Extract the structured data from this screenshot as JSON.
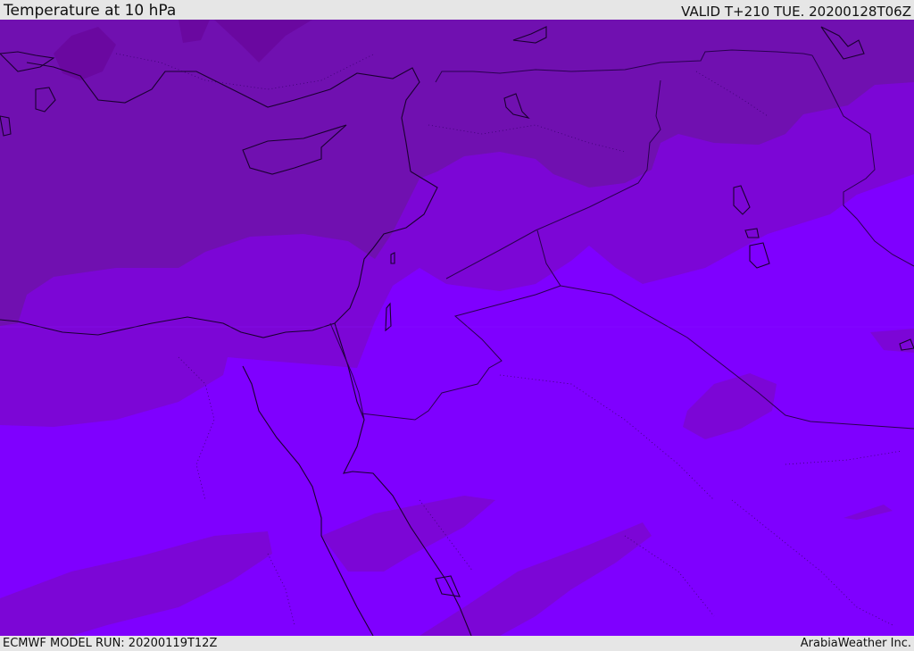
{
  "header": {
    "title": "Temperature at 10 hPa",
    "valid": "VALID T+210 TUE. 20200128T06Z"
  },
  "footer": {
    "model_run": "ECMWF MODEL RUN: 20200119T12Z",
    "credit": "ArabiaWeather Inc."
  },
  "colors": {
    "shade_cold": "#7010b0",
    "shade_mid": "#7c06d6",
    "shade_warm": "#7f00ff",
    "coastline": "#1a0030",
    "border": "#2a0050",
    "bar_bg": "#e6e6e6"
  }
}
